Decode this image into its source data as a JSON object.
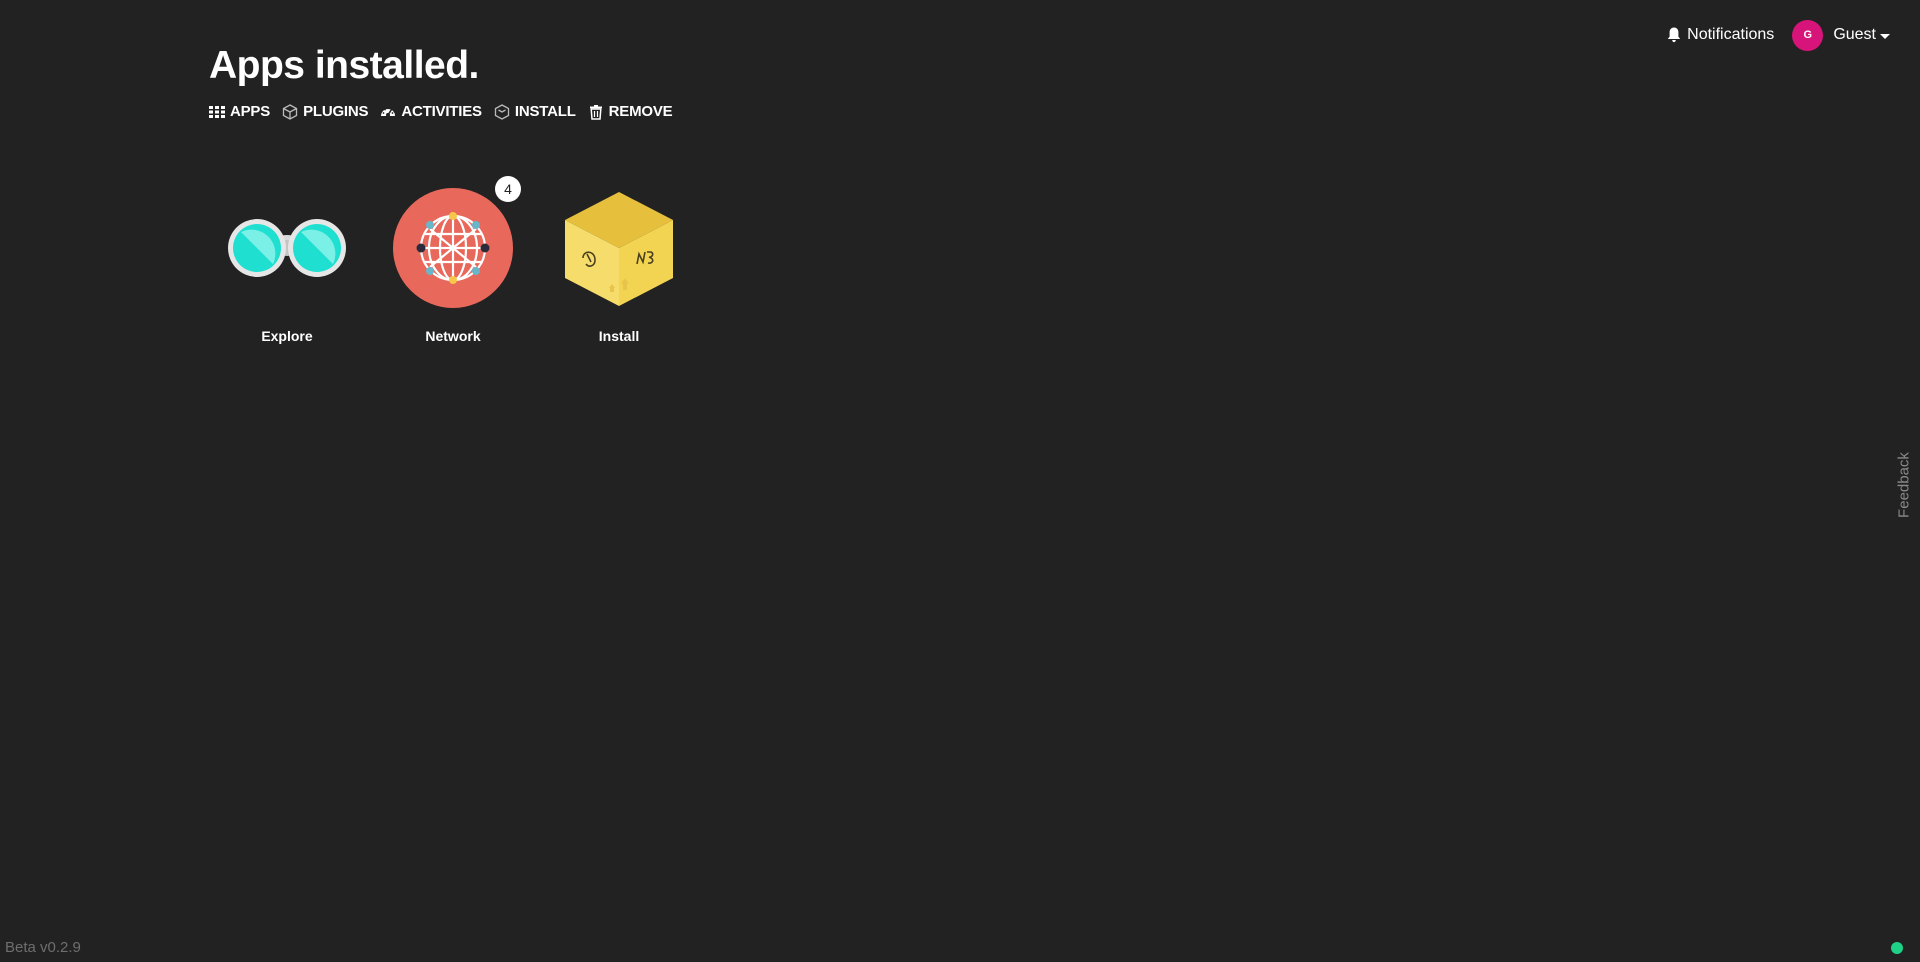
{
  "header": {
    "notifications_label": "Notifications",
    "avatar_initial": "G",
    "user_name": "Guest"
  },
  "title": "Apps installed.",
  "nav": {
    "apps": "APPS",
    "plugins": "PLUGINS",
    "activities": "ACTIVITIES",
    "install": "INSTALL",
    "remove": "REMOVE"
  },
  "apps": [
    {
      "label": "Explore",
      "icon": "binoculars-icon"
    },
    {
      "label": "Network",
      "icon": "network-globe-icon",
      "badge": "4"
    },
    {
      "label": "Install",
      "icon": "box-icon"
    }
  ],
  "feedback_label": "Feedback",
  "version": "Beta v0.2.9",
  "colors": {
    "background": "#222222",
    "avatar": "#d6147a",
    "network": "#e8685b",
    "install_box": "#f5d542",
    "status_online": "#1fd087"
  }
}
